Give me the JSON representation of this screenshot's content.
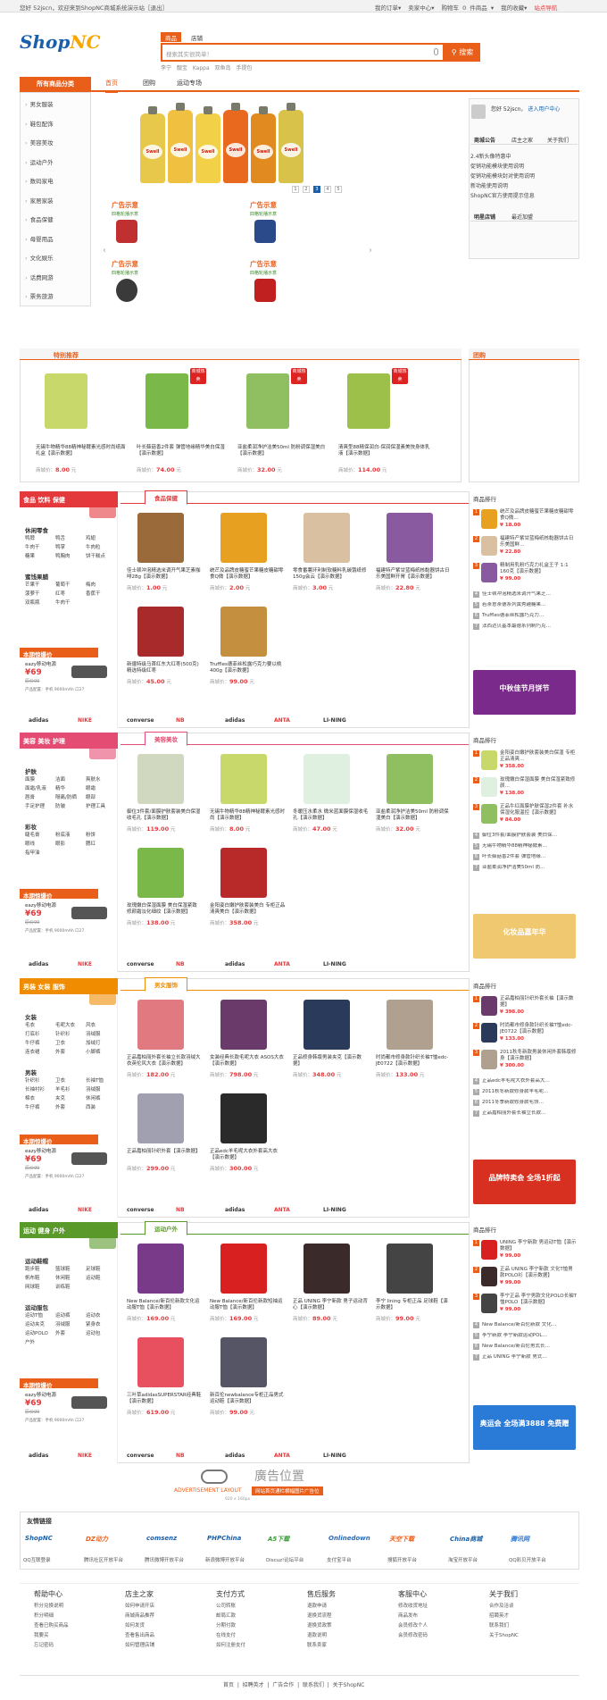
{
  "topbar": {
    "greeting": "您好 52jscn，欢迎来到ShopNC商城系统演示站［退出］",
    "links": [
      "我的订单▾",
      "卖家中心▾",
      "购物车 0 件商品 ▾",
      "我的收藏▾",
      "站点导航"
    ]
  },
  "header": {
    "logo_main": "Shop",
    "logo_accent": "NC",
    "search_tabs": [
      "商品",
      "店铺"
    ],
    "search_placeholder": "搜索其实很简单！",
    "search_button": "搜索",
    "hot_keywords": "李宁  靓宝  Kappa  双鱼岛  手提包"
  },
  "nav": {
    "category_button": "所有商品分类",
    "items": [
      "首页",
      "团购",
      "运动专场"
    ]
  },
  "categories": [
    "男女服装",
    "鞋包配饰",
    "美容美妆",
    "运动户外",
    "数码家电",
    "家居家装",
    "食品保健",
    "母婴用品",
    "文化娱乐",
    "话费网游",
    "票务旅游"
  ],
  "banner": {
    "bottle_colors": [
      "#e8c84a",
      "#f0c040",
      "#f2d048",
      "#e96a1f",
      "#e08a20",
      "#d8c24a"
    ],
    "bottle_label": "Swell",
    "pages": [
      "1",
      "2",
      "3",
      "4",
      "5"
    ],
    "active_page": 3
  },
  "ads": {
    "title": "广告示意",
    "subtitle": "四格轮播示意",
    "count": 4
  },
  "user_panel": {
    "greeting": "您好 52jscn，",
    "center_link": "进入用户中心",
    "tabs": [
      "商城公告",
      "店主之家",
      "关于我们"
    ],
    "notices": [
      "2.4新头像特惠中",
      "促销功能模块使用说明",
      "促销功能模块封对使用说明",
      "新功能使用说明",
      "ShopNC官方使用提示信息"
    ],
    "store_tabs": [
      "明星店铺",
      "最近加盟"
    ]
  },
  "special": {
    "title": "特别推荐",
    "side_title": "团购",
    "badge": "商城热卖",
    "items": [
      {
        "name": "无锡牛物精华88精神秘酵素光感时尚纸面礼盒【演示数据】",
        "price": "8.00",
        "color": "#c9d86a"
      },
      {
        "name": "叶长藓菇香2件套 弹管地缘精华美白保湿【演示数据】",
        "price": "74.00",
        "color": "#7ab84a"
      },
      {
        "name": "亚盐柔润净护洁美50ml 防粉调保湿美白【演示数据】",
        "price": "32.00",
        "color": "#8fbf60"
      },
      {
        "name": "清爽型88精保润白-保润保湿素美快身体乳液【演示数据】",
        "price": "114.00",
        "color": "#9cc04a"
      }
    ],
    "price_label": "商城价："
  },
  "floors": [
    {
      "head": "食品 饮料 保健",
      "tab": "食品保健",
      "head_color": "#e4393c",
      "groups": [
        {
          "title": "休闲零食",
          "words": [
            "鸭脖",
            "鸭舌",
            "鸡翅",
            "牛肉干",
            "鸭掌",
            "牛肉粒",
            "糖果",
            "鸭胸肉",
            "饼干糕点"
          ]
        },
        {
          "title": "蜜饯果脯",
          "words": [
            "芒果干",
            "葡萄干",
            "梅肉",
            "菠萝干",
            "红枣",
            "香蕉干",
            "双瓶瓶",
            "牛肉干"
          ]
        }
      ],
      "products": [
        {
          "name": "佳士顿冲泡精选米调开气果芝素咖啡28g【演示数据】",
          "price": "1.00",
          "color": "#9a6a3a"
        },
        {
          "name": "统芒及品牌皮糖蜜芒果糖皮糖甜零食Q微【演示数据】",
          "price": "2.00",
          "color": "#e8a020"
        },
        {
          "name": "零食番薯环利制软糖料乳碳饿纸修150g会云【演示数据】",
          "price": "3.00",
          "color": "#d8c0a0"
        },
        {
          "name": "福建特产紫甘蓝梅纸核黏器饼古日乐美国鲜开胃【演示数据】",
          "price": "22.80",
          "color": "#8a5aa0"
        },
        {
          "name": "新疆特级马首红东大红枣(500克)精选特级红枣",
          "price": "45.00",
          "color": "#a82a2a"
        },
        {
          "name": "Truffles德菲丝松露巧克力要以桃400g【演示数据】",
          "price": "99.00",
          "color": "#c49040"
        }
      ],
      "rank": [
        {
          "name": "统芒及品牌皮糖蜜芒果糖皮糖甜零食Q微…",
          "price": "18.00"
        },
        {
          "name": "福建特产紫甘蓝梅纸核黏器饼古日乐美国鲜…",
          "price": "22.80"
        },
        {
          "name": "精制用乳粉巧克力礼盒王子 1:1 160克【演示数据】",
          "price": "99.00"
        }
      ],
      "rank_more": [
        "佳士顿冲泡精选米调开气果芝…",
        "若茶意茶德系列黄秀越糖果…",
        "Truffles德菲丝松露巧克力…",
        "法西达贝基本最德系列制巧克…"
      ],
      "promo_color": "#7a2a8a",
      "promo_text": "中秋佳节月饼节"
    },
    {
      "head": "美容 美妆 护理",
      "tab": "美容美妆",
      "head_color": "#e54c73",
      "groups": [
        {
          "title": "护肤",
          "words": [
            "面膜",
            "洁面",
            "爽肤水",
            "面霜/乳液",
            "精华",
            "眼霜",
            "唇膏",
            "隔离/防晒",
            "眼部",
            "手足护理",
            "防皱",
            "护理工具"
          ]
        },
        {
          "title": "彩妆",
          "words": [
            "睫毛膏",
            "粉底液",
            "粉饼",
            "眼线",
            "眼影",
            "腮红",
            "指甲油"
          ]
        }
      ],
      "products": [
        {
          "name": "御位3件套/面膜护肤套装美白保湿收毛孔【演示数据】",
          "price": "119.00",
          "color": "#d0d8c0"
        },
        {
          "name": "无锡牛物精华88精神秘酵素光感时尚【演示数据】",
          "price": "8.00",
          "color": "#c9d86a"
        },
        {
          "name": "冬暖压水柔水 微米蓝面膜保湿收毛孔【演示数据】",
          "price": "47.00",
          "color": "#e0f0e0"
        },
        {
          "name": "亚盐柔润净护洁美50ml 防粉调保湿美白【演示数据】",
          "price": "32.00",
          "color": "#8fbf60"
        },
        {
          "name": "玫瑰嫩白保湿面膜 美白保湿紧致 修颜霜淡化细纹【演示数据】",
          "price": "138.00",
          "color": "#7ab84a"
        },
        {
          "name": "金阳姿白嫩护肤套装美白 专柜正品清爽美白【演示数据】",
          "price": "358.00",
          "color": "#b82a2a"
        }
      ],
      "rank": [
        {
          "name": "金阳姿白嫩护肤套装美白保湿 专柜正品清爽…",
          "price": "358.00"
        },
        {
          "name": "玫瑰嫩白保湿面膜 美白保湿紧致修颜…",
          "price": "138.00"
        },
        {
          "name": "正品牛红面膜护肤保湿2件套 补水保湿化服温控【演示数据】",
          "price": "84.00"
        }
      ],
      "rank_more": [
        "御位3件套/面膜护肤套装 美白保…",
        "无锡牛物精华88精神秘酵素…",
        "叶长藓菇香2件套 弹管地缘…",
        "亚盐柔润净护洁美50ml 防…"
      ],
      "promo_color": "#f0c870",
      "promo_text": "化妆品嘉年华"
    },
    {
      "head": "男装 女装 服饰",
      "tab": "男女服饰",
      "head_color": "#f08c00",
      "groups": [
        {
          "title": "女装",
          "words": [
            "毛衣",
            "毛呢大衣",
            "风衣",
            "打底衫",
            "针织衫",
            "羽绒服",
            "牛仔裤",
            "卫衣",
            "加绒打",
            "连衣裙",
            "外套",
            "小脚裤"
          ]
        },
        {
          "title": "男装",
          "words": [
            "针织衫",
            "卫衣",
            "长袖T恤",
            "长袖衬衫",
            "羊毛衫",
            "羽绒服",
            "棉衣",
            "夹克",
            "休闲裤",
            "牛仔裤",
            "外套",
            "西装"
          ]
        }
      ],
      "products": [
        {
          "name": "正品嘉柏丽外套长袖立长款羽绒大衣英伦风大衣【演示数据】",
          "price": "182.00",
          "color": "#e07a80"
        },
        {
          "name": "女装经典长款毛呢大衣 ASOS大衣【演示数据】",
          "price": "798.00",
          "color": "#6a3a6a"
        },
        {
          "name": "正品修身韩版男装夹克【演示数据】",
          "price": "348.00",
          "color": "#2a3a5a"
        },
        {
          "name": "时尚都市修身款针织长袖T恤edc-JE0722【演示数据】",
          "price": "133.00",
          "color": "#b0a090"
        },
        {
          "name": "正品嘉柏丽针织外套【演示数据】",
          "price": "299.00",
          "color": "#a0a0b0"
        },
        {
          "name": "正品edc羊毛呢大衣外套高大衣【演示数据】",
          "price": "300.00",
          "color": "#2a2a2a"
        }
      ],
      "rank": [
        {
          "name": "正品嘉柏丽针织外套长袖【演示数据】",
          "price": "398.00"
        },
        {
          "name": "时尚都市修身款针织长袖T恤edc-JE0722【演示数据】",
          "price": "133.00"
        },
        {
          "name": "2011秋冬新款男装休闲外套韩版修身【演示数据】",
          "price": "300.00"
        }
      ],
      "rank_more": [
        "正品edc羊毛呢大衣外套高大…",
        "2011秋冬新款修身款羊毛呢…",
        "2011冬季新款修身款毛领…",
        "正品嘉柏丽外套长袖立长款…"
      ],
      "promo_color": "#d83020",
      "promo_text": "品牌特卖会 全场1折起"
    },
    {
      "head": "运动 健身 户外",
      "tab": "运动户外",
      "head_color": "#5a9a2a",
      "groups": [
        {
          "title": "运动鞋帽",
          "words": [
            "跑步鞋",
            "篮球鞋",
            "足球鞋",
            "帆布鞋",
            "休闲鞋",
            "运动鞋",
            "网球鞋",
            "训练鞋"
          ]
        },
        {
          "title": "运动服包",
          "words": [
            "运动T恤",
            "运动裤",
            "运动衣",
            "运动夹克",
            "羽绒服",
            "紧身衣",
            "运动POLO",
            "外套",
            "运动包",
            "户外"
          ]
        }
      ],
      "products": [
        {
          "name": "New Balance/新百伦新款文化运动服T恤【演示数据】",
          "price": "169.00",
          "color": "#7a3a8a"
        },
        {
          "name": "New Balance/新百伦新款短袖运动服T恤【演示数据】",
          "price": "169.00",
          "color": "#d82020"
        },
        {
          "name": "正品 UNING 李宁新款 男子运动背心【演示数据】",
          "price": "89.00",
          "color": "#3a2a2a"
        },
        {
          "name": "李宁 lining 专柜正品 足球鞋【演示数据】",
          "price": "99.00",
          "color": "#444444"
        },
        {
          "name": "三叶草adidasSUPERSTAR经典鞋【演示数据】",
          "price": "619.00",
          "color": "#e85060"
        },
        {
          "name": "新百伦newbalance专柜正品男式运动鞋【演示数据】",
          "price": "99.00",
          "color": "#555566"
        }
      ],
      "rank": [
        {
          "name": "UNING 李宁新款 男运动T恤【演示数据】",
          "price": "99.00"
        },
        {
          "name": "正品 UNING 李宁新款 文化T恤男款POLO衫【演示数据】",
          "price": "99.00"
        },
        {
          "name": "李宁正品 李宁男款文化POLO长袖T恤POLO【演示数据】",
          "price": "99.00"
        }
      ],
      "rank_more": [
        "New Balance/新百伦新款 文化…",
        "李宁新款 李宁新款运动POL…",
        "New Balance/新百伦男式长…",
        "正品 UNING 李宁新款 男式…"
      ],
      "promo_color": "#2a7ad8",
      "promo_text": "奥运会 全场满3888 免费赠"
    }
  ],
  "week_bar": {
    "title": "本期惊爆价",
    "item": "eazy移动电源",
    "price": "69",
    "old_price": "原价99",
    "note": "产品配置：手机 9000mAh 口27"
  },
  "brands": [
    "adidas",
    "NIKE",
    "converse",
    "NB",
    "adidas",
    "ANTA",
    "LI-NING"
  ],
  "rank_title": "商品排行",
  "ad_banner": {
    "main": "廣告位置",
    "sub": "ADVERTISEMENT LAYOUT",
    "cta": "网站首页通栏横幅图片广告位",
    "size": "920 x 160px"
  },
  "friend_links": {
    "title": "友情链接",
    "logos": [
      "ShopNC",
      "DZ动力",
      "comsenz",
      "PHPChina",
      "A5下载",
      "Onlinedown",
      "天空下载",
      "China商城",
      "腾讯网"
    ],
    "captions": [
      "QQ互联登录",
      "腾讯社区开放平台",
      "腾讯微博开放平台",
      "新浪微博开放平台",
      "Discuz!论坛平台",
      "支付宝平台",
      "搜狐开放平台",
      "淘宝开放平台",
      "QQ彩贝开放平台"
    ]
  },
  "footer": {
    "cols": [
      {
        "title": "帮助中心",
        "items": [
          "积分兑换说明",
          "积分明细",
          "查看已购买商品",
          "我要买",
          "忘记密码"
        ]
      },
      {
        "title": "店主之家",
        "items": [
          "如何申请开店",
          "商城商品推荐",
          "如何发货",
          "查看售出商品",
          "如何管理店铺"
        ]
      },
      {
        "title": "支付方式",
        "items": [
          "公司转账",
          "邮局汇款",
          "分期付款",
          "在线支付",
          "如何注册支付"
        ]
      },
      {
        "title": "售后服务",
        "items": [
          "退款申请",
          "退换货流程",
          "退换货政策",
          "退款说明",
          "联系卖家"
        ]
      },
      {
        "title": "客服中心",
        "items": [
          "修改收货地址",
          "商品发布",
          "会员修改个人",
          "会员修改密码"
        ]
      },
      {
        "title": "关于我们",
        "items": [
          "合作及洽谈",
          "招聘英才",
          "联系我们",
          "关于ShopNC"
        ]
      }
    ],
    "bottom_links": "首页  |  招聘英才  |  广告合作  |  联系我们  |  关于ShopNC"
  }
}
